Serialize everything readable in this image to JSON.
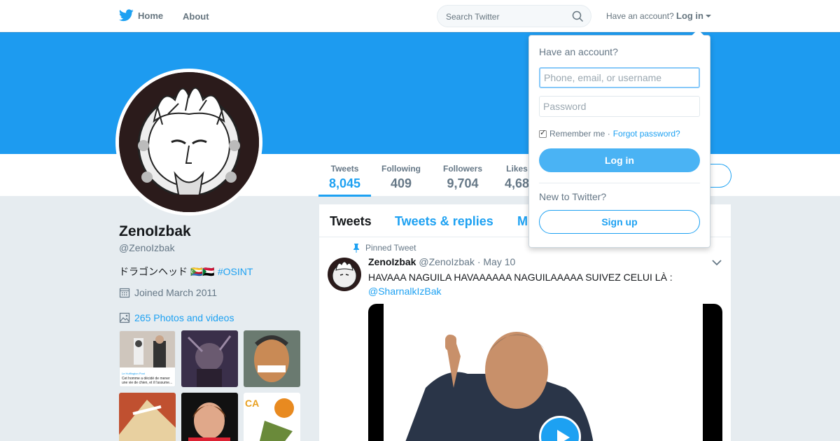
{
  "nav": {
    "home_label": "Home",
    "about_label": "About",
    "search_placeholder": "Search Twitter",
    "have_account": "Have an account?",
    "login_label": "Log in"
  },
  "colors": {
    "accent": "#1da1f2",
    "banner": "#1d9bf0"
  },
  "profile": {
    "name": "ZenoIzbak",
    "handle": "@ZenoIzbak",
    "bio_text": "ドラゴンヘッド",
    "bio_flags": "🇰🇲🇸🇩",
    "bio_hashtag": "#OSINT",
    "joined": "Joined March 2011",
    "photos_label": "265 Photos and videos"
  },
  "stats": [
    {
      "label": "Tweets",
      "value": "8,045"
    },
    {
      "label": "Following",
      "value": "409"
    },
    {
      "label": "Followers",
      "value": "9,704"
    },
    {
      "label": "Likes",
      "value": "4,68"
    }
  ],
  "timeline": {
    "tabs": [
      "Tweets",
      "Tweets & replies",
      "M"
    ],
    "pinned_label": "Pinned Tweet",
    "tweet": {
      "name": "ZenoIzbak",
      "handle": "@ZenoIzbak",
      "date": "· May 10",
      "text": "HAVAAA NAGUILA HAVAAAAAA NAGUILAAAAA SUIVEZ CELUI LÀ :",
      "mention": "@SharnalkIzBak"
    }
  },
  "login_dropdown": {
    "title": "Have an account?",
    "username_placeholder": "Phone, email, or username",
    "password_placeholder": "Password",
    "remember_label": "Remember me ·",
    "forgot_label": "Forgot password?",
    "login_button": "Log in",
    "new_label": "New to Twitter?",
    "signup_button": "Sign up"
  },
  "thumbnails": {
    "first_caption_top": "Le Huffington Post",
    "first_caption": "Cet homme a décidé de mener une vie de chien, et il l'assume..."
  }
}
